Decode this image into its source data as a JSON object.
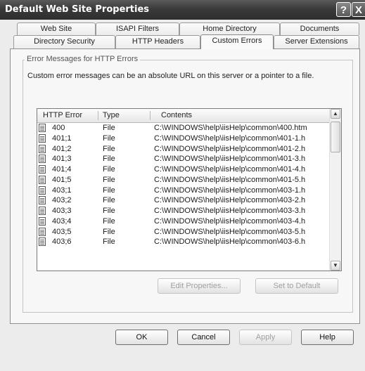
{
  "window": {
    "title": "Default Web Site Properties",
    "help_glyph": "?",
    "close_glyph": "X"
  },
  "tabs_back": [
    "Web Site",
    "ISAPI Filters",
    "Home Directory",
    "Documents"
  ],
  "tabs_front": [
    "Directory Security",
    "HTTP Headers",
    "Custom Errors",
    "Server Extensions"
  ],
  "active_tab": "Custom Errors",
  "group": {
    "title": "Error Messages for HTTP Errors",
    "description": "Custom error messages can be an absolute URL on this server or a pointer to a file."
  },
  "list": {
    "columns": [
      "HTTP Error",
      "Type",
      "Contents"
    ],
    "rows": [
      {
        "error": "400",
        "type": "File",
        "contents": "C:\\WINDOWS\\help\\iisHelp\\common\\400.htm"
      },
      {
        "error": "401;1",
        "type": "File",
        "contents": "C:\\WINDOWS\\help\\iisHelp\\common\\401-1.h"
      },
      {
        "error": "401;2",
        "type": "File",
        "contents": "C:\\WINDOWS\\help\\iisHelp\\common\\401-2.h"
      },
      {
        "error": "401;3",
        "type": "File",
        "contents": "C:\\WINDOWS\\help\\iisHelp\\common\\401-3.h"
      },
      {
        "error": "401;4",
        "type": "File",
        "contents": "C:\\WINDOWS\\help\\iisHelp\\common\\401-4.h"
      },
      {
        "error": "401;5",
        "type": "File",
        "contents": "C:\\WINDOWS\\help\\iisHelp\\common\\401-5.h"
      },
      {
        "error": "403;1",
        "type": "File",
        "contents": "C:\\WINDOWS\\help\\iisHelp\\common\\403-1.h"
      },
      {
        "error": "403;2",
        "type": "File",
        "contents": "C:\\WINDOWS\\help\\iisHelp\\common\\403-2.h"
      },
      {
        "error": "403;3",
        "type": "File",
        "contents": "C:\\WINDOWS\\help\\iisHelp\\common\\403-3.h"
      },
      {
        "error": "403;4",
        "type": "File",
        "contents": "C:\\WINDOWS\\help\\iisHelp\\common\\403-4.h"
      },
      {
        "error": "403;5",
        "type": "File",
        "contents": "C:\\WINDOWS\\help\\iisHelp\\common\\403-5.h"
      },
      {
        "error": "403;6",
        "type": "File",
        "contents": "C:\\WINDOWS\\help\\iisHelp\\common\\403-6.h"
      }
    ]
  },
  "buttons": {
    "edit_properties": "Edit Properties...",
    "set_to_default": "Set to Default",
    "ok": "OK",
    "cancel": "Cancel",
    "apply": "Apply",
    "help": "Help"
  },
  "icons": {
    "file_row": "document-icon",
    "scroll_up": "scroll-up-arrow-icon",
    "scroll_down": "scroll-down-arrow-icon"
  },
  "colors": {
    "titlebar": "#3a3a3a",
    "dialog_bg": "#ececec",
    "panel_bg": "#f7f7f7"
  }
}
